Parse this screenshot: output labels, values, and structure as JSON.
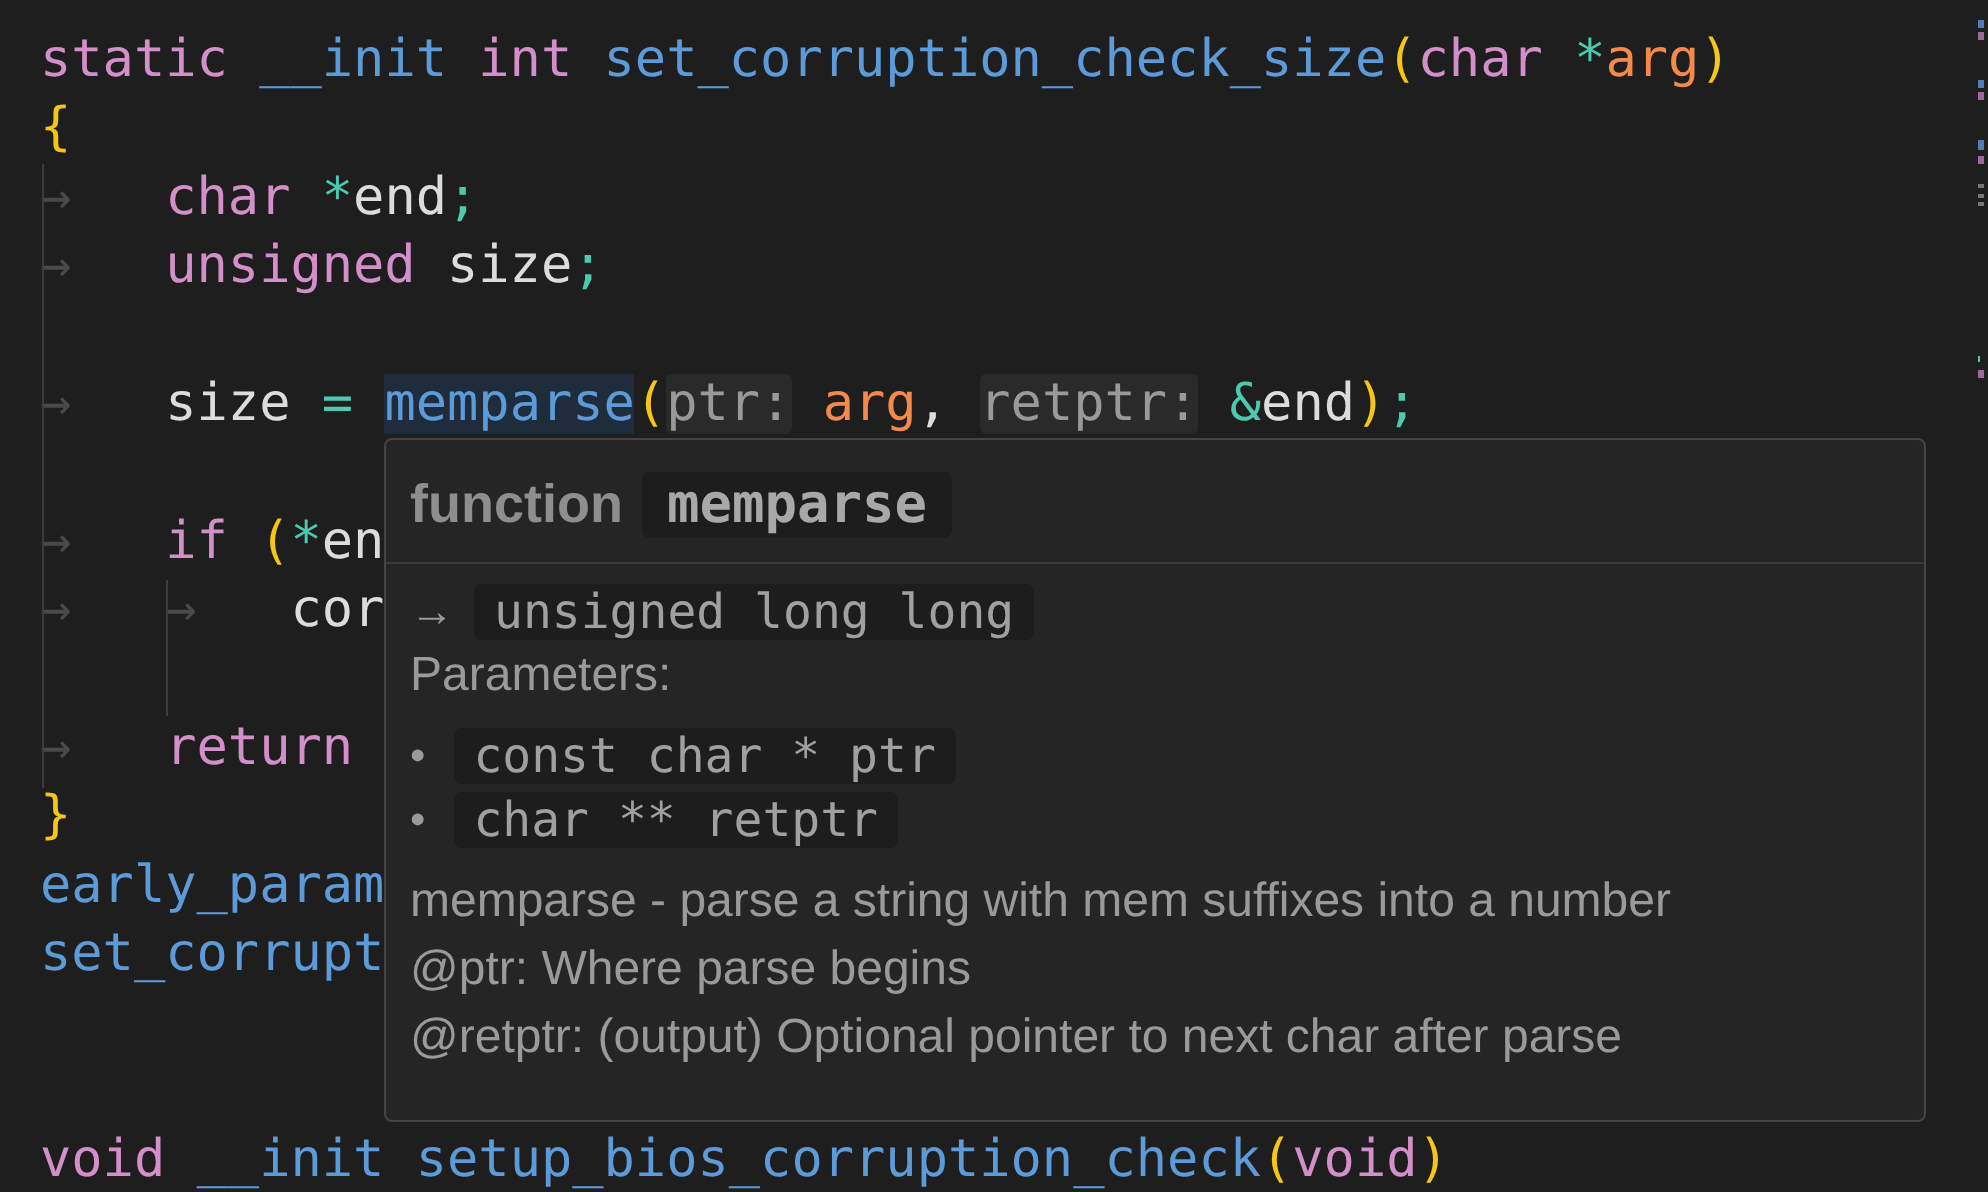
{
  "editor": {
    "lines": [
      {
        "kind": "code",
        "tokens": [
          {
            "text": "static ",
            "kind": "keyword"
          },
          {
            "text": "__init ",
            "kind": "function"
          },
          {
            "text": "int ",
            "kind": "keyword"
          },
          {
            "text": "set_corruption_check_size",
            "kind": "function"
          },
          {
            "text": "(",
            "kind": "bracket"
          },
          {
            "text": "char ",
            "kind": "keyword"
          },
          {
            "text": "*",
            "kind": "operator"
          },
          {
            "text": "arg",
            "kind": "parameter"
          },
          {
            "text": ")",
            "kind": "bracket"
          }
        ]
      },
      {
        "kind": "code",
        "tokens": [
          {
            "text": "{",
            "kind": "bracket"
          }
        ]
      },
      {
        "kind": "code",
        "tokens": [
          {
            "text": "→",
            "kind": "tab"
          },
          {
            "text": "char ",
            "kind": "keyword"
          },
          {
            "text": "*",
            "kind": "operator"
          },
          {
            "text": "end",
            "kind": "plain"
          },
          {
            "text": ";",
            "kind": "operator"
          }
        ]
      },
      {
        "kind": "code",
        "tokens": [
          {
            "text": "→",
            "kind": "tab"
          },
          {
            "text": "unsigned",
            "kind": "keyword"
          },
          {
            "text": " size",
            "kind": "plain"
          },
          {
            "text": ";",
            "kind": "operator"
          }
        ]
      },
      {
        "kind": "blank"
      },
      {
        "kind": "code",
        "tokens": [
          {
            "text": "→",
            "kind": "tab"
          },
          {
            "text": "size ",
            "kind": "plain"
          },
          {
            "text": "= ",
            "kind": "operator"
          },
          {
            "text": "memparse",
            "kind": "function_highlighted"
          },
          {
            "text": "(",
            "kind": "bracket"
          },
          {
            "text": "ptr:",
            "kind": "hint"
          },
          {
            "text": " arg",
            "kind": "parameter"
          },
          {
            "text": ", ",
            "kind": "plain"
          },
          {
            "text": "retptr:",
            "kind": "hint"
          },
          {
            "text": " &",
            "kind": "operator"
          },
          {
            "text": "end",
            "kind": "plain"
          },
          {
            "text": ")",
            "kind": "bracket"
          },
          {
            "text": ";",
            "kind": "operator"
          }
        ]
      },
      {
        "kind": "blank"
      },
      {
        "kind": "code",
        "tokens": [
          {
            "text": "→",
            "kind": "tab"
          },
          {
            "text": "if ",
            "kind": "keyword"
          },
          {
            "text": "(",
            "kind": "bracket"
          },
          {
            "text": "*",
            "kind": "operator"
          },
          {
            "text": "en",
            "kind": "plain"
          }
        ]
      },
      {
        "kind": "code",
        "tokens": [
          {
            "text": "→",
            "kind": "tab"
          },
          {
            "text": "→",
            "kind": "tab"
          },
          {
            "text": "cor",
            "kind": "plain"
          }
        ]
      },
      {
        "kind": "blank"
      },
      {
        "kind": "code",
        "tokens": [
          {
            "text": "→",
            "kind": "tab"
          },
          {
            "text": "return",
            "kind": "keyword"
          }
        ]
      },
      {
        "kind": "code",
        "tokens": [
          {
            "text": "}",
            "kind": "bracket"
          }
        ]
      },
      {
        "kind": "code",
        "tokens": [
          {
            "text": "early_param",
            "kind": "function"
          }
        ]
      },
      {
        "kind": "code",
        "tokens": [
          {
            "text": "set_corrupt",
            "kind": "function"
          }
        ]
      },
      {
        "kind": "blank"
      },
      {
        "kind": "blank"
      },
      {
        "kind": "code",
        "tokens": [
          {
            "text": "void ",
            "kind": "keyword"
          },
          {
            "text": "__init ",
            "kind": "function"
          },
          {
            "text": "setup_bios_corruption_check",
            "kind": "function"
          },
          {
            "text": "(",
            "kind": "bracket"
          },
          {
            "text": "void",
            "kind": "keyword"
          },
          {
            "text": ")",
            "kind": "bracket"
          }
        ]
      }
    ]
  },
  "hover": {
    "kind_label": "function",
    "name": "memparse",
    "return_arrow": "→",
    "return_type": "unsigned long long",
    "parameters_label": "Parameters:",
    "parameters": [
      {
        "bullet": "•",
        "type": "const char * ptr"
      },
      {
        "bullet": "•",
        "type": "char ** retptr"
      }
    ],
    "description": [
      "memparse - parse a string with mem suffixes into a number",
      "@ptr: Where parse begins",
      "@retptr: (output) Optional pointer to next char after parse"
    ]
  }
}
